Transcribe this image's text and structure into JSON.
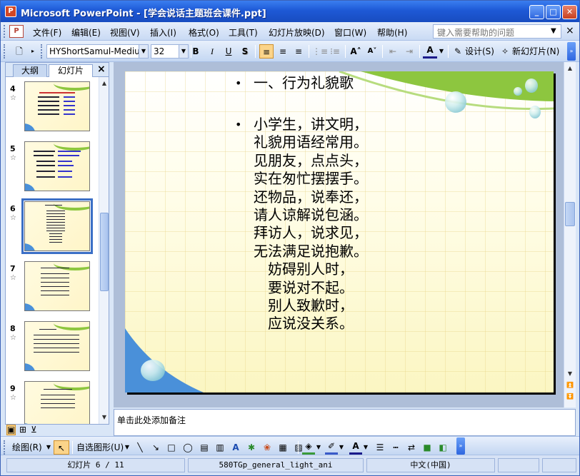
{
  "window": {
    "title": "Microsoft PowerPoint - [学会说话主题班会课件.ppt]",
    "app_icon": "P"
  },
  "menu": {
    "items": [
      "文件(F)",
      "编辑(E)",
      "视图(V)",
      "插入(I)",
      "格式(O)",
      "工具(T)",
      "幻灯片放映(D)",
      "窗口(W)",
      "帮助(H)"
    ],
    "help_placeholder": "键入需要帮助的问题"
  },
  "toolbar": {
    "font_name": "HYShortSamul-Mediu",
    "font_size": "32",
    "bold": "B",
    "italic": "I",
    "underline": "U",
    "shadow": "S",
    "design_label": "设计(S)",
    "new_slide_label": "新幻灯片(N)"
  },
  "left_pane": {
    "tabs": [
      "大纲",
      "幻灯片"
    ],
    "thumbs": [
      {
        "num": "4",
        "selected": false
      },
      {
        "num": "5",
        "selected": false
      },
      {
        "num": "6",
        "selected": true
      },
      {
        "num": "7",
        "selected": false
      },
      {
        "num": "8",
        "selected": false
      },
      {
        "num": "9",
        "selected": false
      }
    ]
  },
  "slide": {
    "heading": "一、行为礼貌歌",
    "lines": [
      "小学生，讲文明，",
      "礼貌用语经常用。",
      "见朋友，点点头，",
      "实在匆忙摆摆手。",
      "还物品，说奉还，",
      "请人谅解说包涵。",
      "拜访人，说求见，",
      "无法满足说抱歉。"
    ],
    "indented_lines": [
      "妨碍别人时，",
      "要说对不起。",
      "别人致歉时，",
      "应说没关系。"
    ]
  },
  "notes_placeholder": "单击此处添加备注",
  "drawing": {
    "draw_label": "绘图(R)",
    "autoshapes_label": "自选图形(U)"
  },
  "status": {
    "slide": "幻灯片 6 / 11",
    "design": "580TGp_general_light_ani",
    "language": "中文(中国)"
  },
  "colors": {
    "title_bar": "#1e59d6",
    "slide_bg": "#fffde8",
    "accent_green": "#8dc63f",
    "accent_blue": "#4a90d9"
  }
}
